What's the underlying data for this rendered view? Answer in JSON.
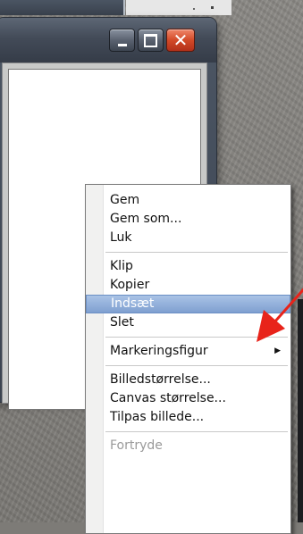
{
  "window": {
    "minimize_icon": "minimize-icon",
    "maximize_icon": "maximize-icon",
    "close_icon": "close-icon",
    "close_glyph": "✕"
  },
  "context_menu": {
    "groups": [
      [
        {
          "label": "Gem",
          "state": "normal"
        },
        {
          "label": "Gem som...",
          "state": "normal"
        },
        {
          "label": "Luk",
          "state": "normal"
        }
      ],
      [
        {
          "label": "Klip",
          "state": "normal"
        },
        {
          "label": "Kopier",
          "state": "normal"
        },
        {
          "label": "Indsæt",
          "state": "selected"
        },
        {
          "label": "Slet",
          "state": "normal"
        }
      ],
      [
        {
          "label": "Markeringsfigur",
          "state": "normal",
          "submenu": true
        }
      ],
      [
        {
          "label": "Billedstørrelse...",
          "state": "normal"
        },
        {
          "label": "Canvas størrelse...",
          "state": "normal"
        },
        {
          "label": "Tilpas billede...",
          "state": "normal"
        }
      ],
      [
        {
          "label": "Fortryde",
          "state": "disabled"
        }
      ]
    ],
    "submenu_arrow": "▶"
  },
  "annotation": {
    "arrow_color": "#e8231a",
    "arrow_icon": "red-arrow-icon"
  },
  "colors": {
    "selection": "#8aa9d8",
    "close_button": "#d24a28"
  }
}
